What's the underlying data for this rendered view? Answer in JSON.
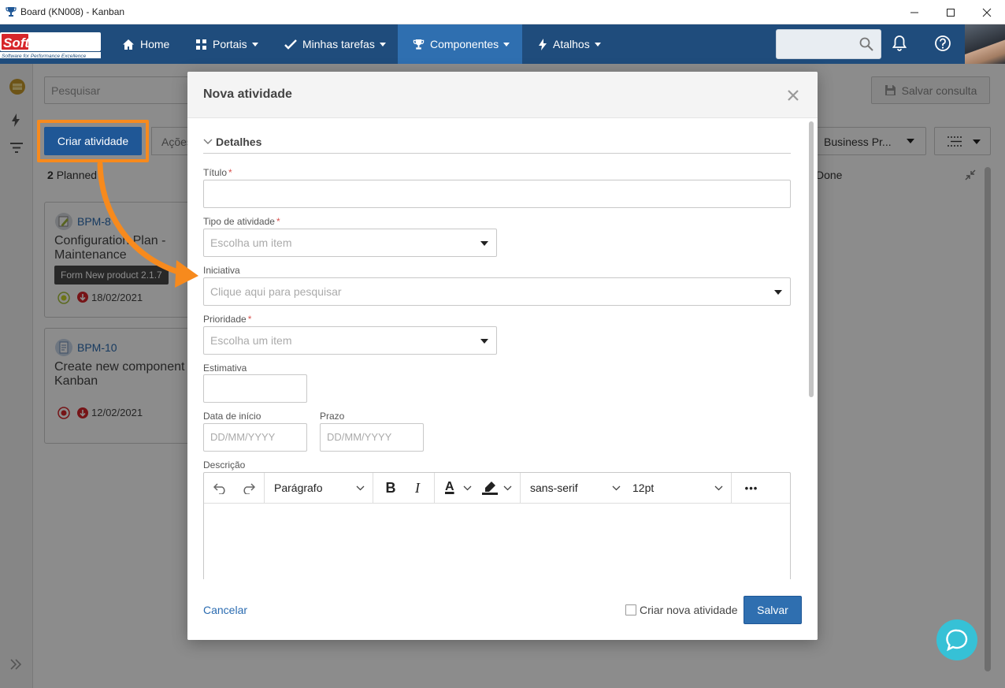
{
  "window": {
    "title": "Board (KN008) - Kanban"
  },
  "brand": {
    "logo_top": "SoftExpert",
    "logo_tag": "Software for Performance Excellence"
  },
  "nav": {
    "home": "Home",
    "portais": "Portais",
    "minhas_tarefas": "Minhas tarefas",
    "componentes": "Componentes",
    "atalhos": "Atalhos"
  },
  "board": {
    "search_placeholder": "Pesquisar",
    "create_button": "Criar atividade",
    "actions_button": "Ações",
    "save_query": "Salvar consulta",
    "bp_select": "Business Pr...",
    "planned_count": "2",
    "planned_label": "Planned",
    "done_label": "Done",
    "cards": [
      {
        "code": "BPM-8",
        "title": "Configuration Plan - Maintenance",
        "tag": "Form New product 2.1.7",
        "date": "18/02/2021"
      },
      {
        "code": "BPM-10",
        "title": "Create new component Kanban",
        "date": "12/02/2021"
      }
    ]
  },
  "modal": {
    "title": "Nova atividade",
    "section": "Detalhes",
    "fields": {
      "titulo_label": "Título",
      "tipo_label": "Tipo de atividade",
      "tipo_placeholder": "Escolha um item",
      "iniciativa_label": "Iniciativa",
      "iniciativa_placeholder": "Clique aqui para pesquisar",
      "prioridade_label": "Prioridade",
      "prioridade_placeholder": "Escolha um item",
      "estimativa_label": "Estimativa",
      "inicio_label": "Data de início",
      "inicio_placeholder": "DD/MM/YYYY",
      "prazo_label": "Prazo",
      "prazo_placeholder": "DD/MM/YYYY",
      "descricao_label": "Descrição",
      "required_mark": "*"
    },
    "editor": {
      "block_format": "Parágrafo",
      "bold": "B",
      "italic": "I",
      "font_color": "A",
      "font_family": "sans-serif",
      "font_size": "12pt",
      "more": "•••"
    },
    "footer": {
      "cancel": "Cancelar",
      "create_another": "Criar nova atividade",
      "save": "Salvar"
    }
  },
  "colors": {
    "header_bg": "#1f4c7c",
    "nav_active": "#2f6fb0",
    "primary": "#2f6fb0",
    "highlight": "#f78a1d",
    "link": "#2a6bb0",
    "required": "#d9534f",
    "chat": "#36c1d6"
  }
}
